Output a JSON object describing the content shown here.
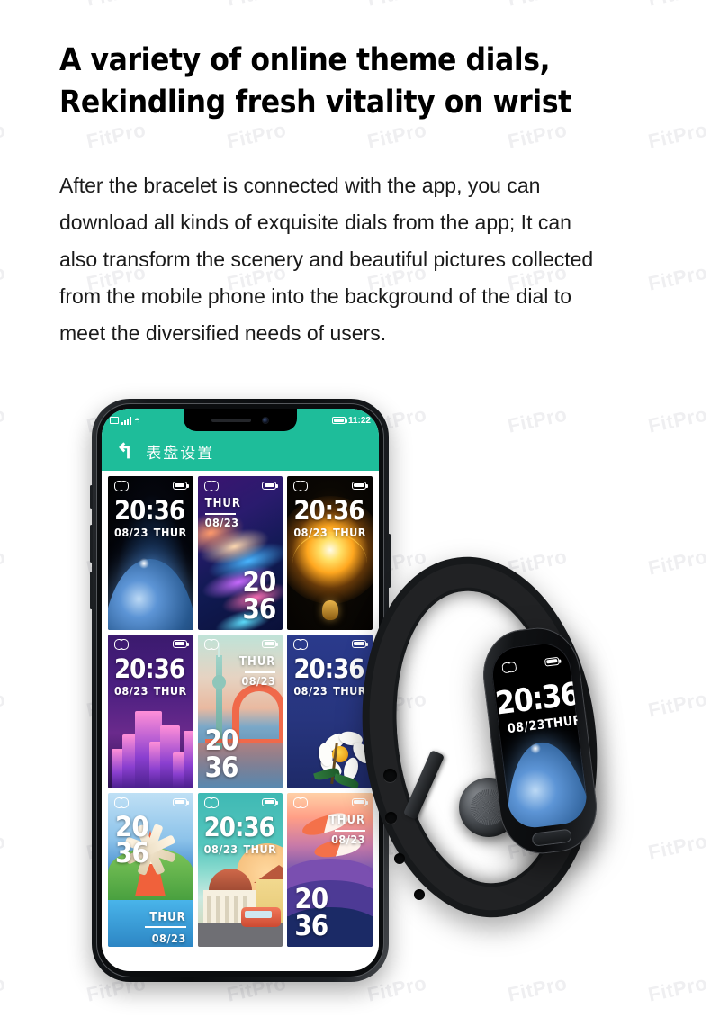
{
  "watermark": {
    "text": "FitPro"
  },
  "headline": {
    "line1": "A variety of online theme dials,",
    "line2": "Rekindling fresh vitality on wrist"
  },
  "body": {
    "line1": "After the bracelet is connected with the app, you can",
    "line2": "download all kinds of exquisite dials from the app; It can",
    "line3": "also transform the scenery and beautiful pictures collected",
    "line4": "from the mobile phone into the background of the dial to",
    "line5": "meet the diversified needs of users."
  },
  "phone": {
    "statusbar": {
      "time": "11:22"
    },
    "appbar": {
      "back": "↰",
      "title": "表盘设置"
    },
    "dials": [
      {
        "name": "earth-dial",
        "time": "20:36",
        "date": "08/23",
        "day": "THUR",
        "layout": "lay-topwide",
        "art": "art-earth"
      },
      {
        "name": "wave-dial",
        "time": "2036",
        "date": "08/23",
        "day": "THUR",
        "layout": "lay-tl",
        "art": "art-wave"
      },
      {
        "name": "sunburst-dial",
        "time": "20:36",
        "date": "08/23",
        "day": "THUR",
        "layout": "lay-topwide",
        "art": "art-sun"
      },
      {
        "name": "city-dial",
        "time": "20:36",
        "date": "08/23",
        "day": "THUR",
        "layout": "lay-topwide",
        "art": "art-city"
      },
      {
        "name": "bridge-dial",
        "time": "2036",
        "date": "08/23",
        "day": "THUR",
        "layout": "lay-tr",
        "art": "art-bridge"
      },
      {
        "name": "flower-dial",
        "time": "20:36",
        "date": "08/23",
        "day": "THUR",
        "layout": "lay-topwide",
        "art": "art-flower"
      },
      {
        "name": "windmill-dial",
        "time": "2036",
        "date": "08/23",
        "day": "THUR",
        "layout": "lay-stackTL",
        "art": "art-windmill"
      },
      {
        "name": "village-dial",
        "time": "20:36",
        "date": "08/23",
        "day": "THUR",
        "layout": "lay-topwide",
        "art": "art-village"
      },
      {
        "name": "dolphin-dial",
        "time": "2036",
        "date": "08/23",
        "day": "THUR",
        "layout": "lay-tr",
        "art": "art-dolphin"
      }
    ]
  },
  "bracelet": {
    "screen": {
      "time": "20:36",
      "date": "08/23",
      "day": "THUR"
    }
  },
  "colors": {
    "accent_teal": "#1ebd9a",
    "headline": "#000000",
    "body_text": "#1a1a1a",
    "watermark": "#efeff1",
    "page_bg": "#ffffff"
  }
}
